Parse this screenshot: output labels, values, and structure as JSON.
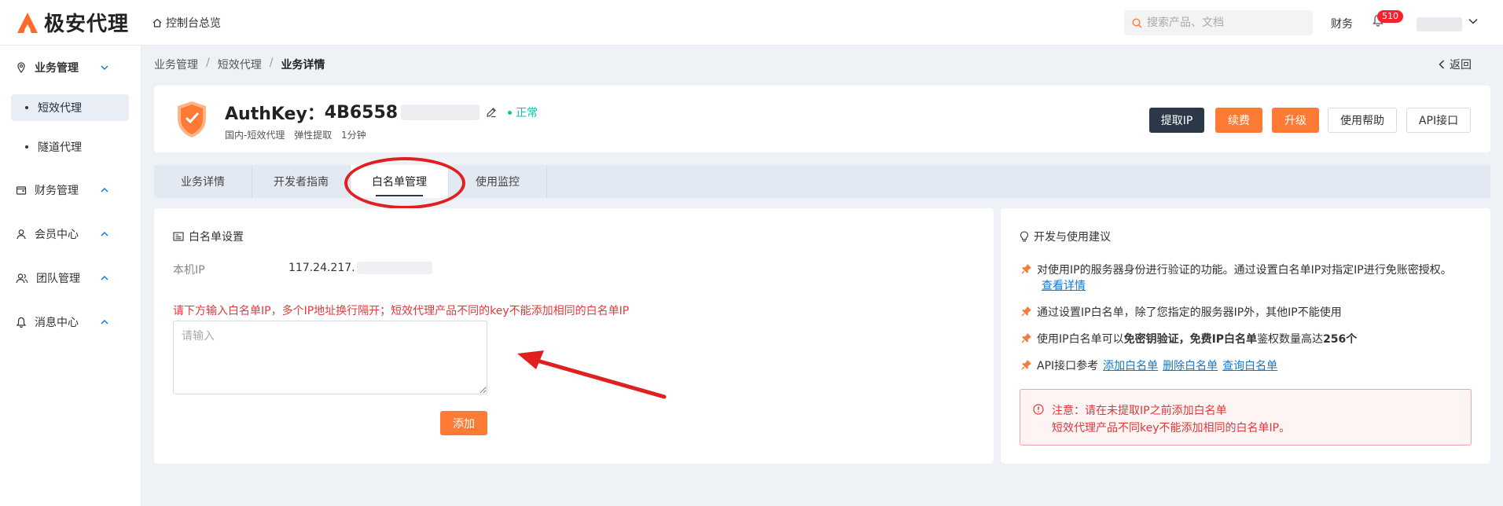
{
  "header": {
    "logo_text": "极安代理",
    "console_link": "控制台总览",
    "search_placeholder": "搜索产品、文档",
    "finance_link": "财务",
    "notification_count": "510"
  },
  "sidebar": {
    "groups": [
      {
        "label": "业务管理",
        "expanded": true
      },
      {
        "label": "财务管理",
        "expanded": false
      },
      {
        "label": "会员中心",
        "expanded": false
      },
      {
        "label": "团队管理",
        "expanded": false
      },
      {
        "label": "消息中心",
        "expanded": false
      }
    ],
    "sub_items": [
      {
        "label": "短效代理",
        "active": true
      },
      {
        "label": "隧道代理",
        "active": false
      }
    ]
  },
  "breadcrumb": {
    "items": [
      "业务管理",
      "短效代理",
      "业务详情"
    ],
    "separator": "/"
  },
  "back_label": "返回",
  "product": {
    "authkey_prefix": "AuthKey：",
    "authkey_visible": "4B6558",
    "status": "正常",
    "region": "国内-短效代理",
    "mode": "弹性提取",
    "interval": "1分钟"
  },
  "actions": {
    "extract_ip": "提取IP",
    "renew": "续费",
    "upgrade": "升级",
    "help": "使用帮助",
    "api": "API接口"
  },
  "tabs": [
    {
      "label": "业务详情",
      "active": false
    },
    {
      "label": "开发者指南",
      "active": false
    },
    {
      "label": "白名单管理",
      "active": true
    },
    {
      "label": "使用监控",
      "active": false
    }
  ],
  "whitelist": {
    "title": "白名单设置",
    "ip_label": "本机IP",
    "ip_value": "117.24.217.",
    "hint": "请下方输入白名单IP，多个IP地址换行隔开；短效代理产品不同的key不能添加相同的白名单IP",
    "textarea_placeholder": "请输入",
    "add_button": "添加"
  },
  "tips": {
    "title": "开发与使用建议",
    "item1_text": "对使用IP的服务器身份进行验证的功能。通过设置白名单IP对指定IP进行免账密授权。",
    "item1_link": "查看详情",
    "item2_text": "通过设置IP白名单，除了您指定的服务器IP外，其他IP不能使用",
    "item3_pre": "使用IP白名单可以",
    "item3_bold1": "免密钥验证，免费IP白名单",
    "item3_mid": "鉴权数量高达",
    "item3_bold2": "256个",
    "item4_text": "API接口参考",
    "item4_links": [
      "添加白名单",
      "删除白名单",
      "查询白名单"
    ],
    "warning_line1": "注意：请在未提取IP之前添加白名单",
    "warning_line2": "短效代理产品不同key不能添加相同的白名单IP。"
  },
  "colors": {
    "accent_orange": "#ff7a35",
    "dark_button": "#2b3848",
    "status_green": "#13c2a2",
    "warning_red": "#d93a3a",
    "link_blue": "#1677c8"
  }
}
